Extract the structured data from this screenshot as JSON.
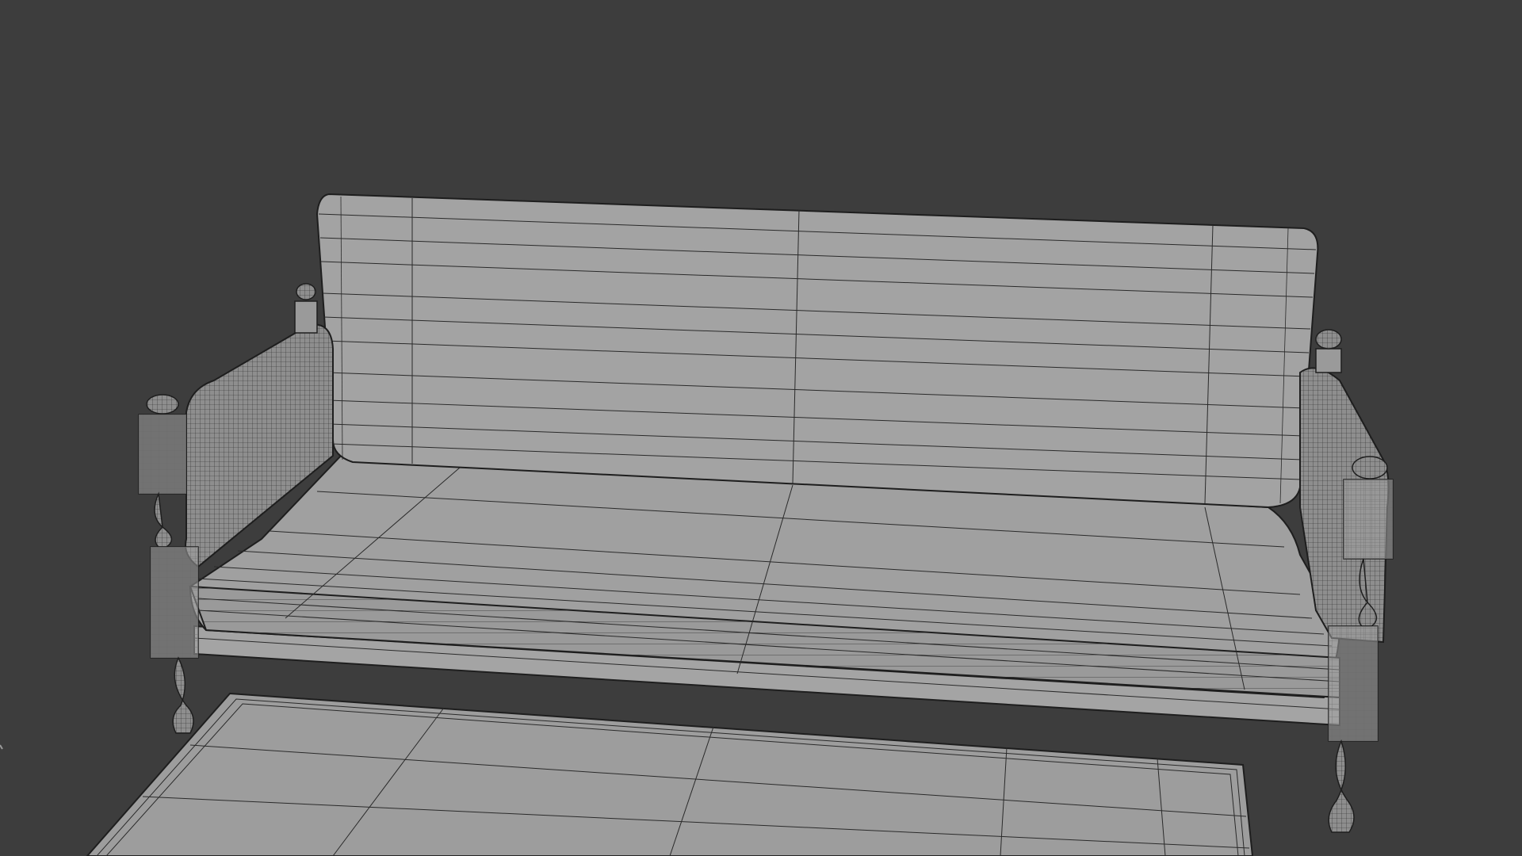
{
  "viewport": {
    "background_color": "#3d3d3d",
    "surface_color": "#9a9a9a",
    "wire_color": "#222222"
  },
  "scene": {
    "objects": [
      "sofa",
      "rug"
    ],
    "shading": "solid-wireframe"
  }
}
